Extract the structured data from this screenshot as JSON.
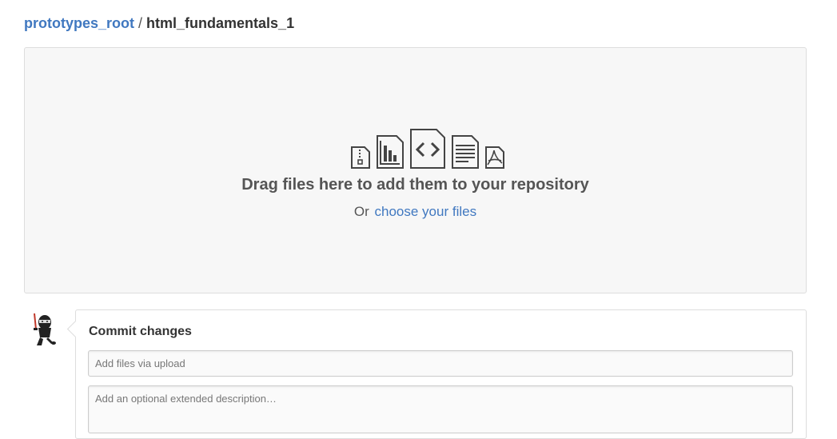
{
  "breadcrumb": {
    "owner": "prototypes_root",
    "separator": "/",
    "repo": "html_fundamentals_1"
  },
  "dropzone": {
    "icons": [
      "file-zip-icon",
      "file-media-icon",
      "file-code-icon",
      "file-text-icon",
      "file-pdf-icon"
    ],
    "title": "Drag files here to add them to your repository",
    "or_text": "Or",
    "choose_link": "choose your files"
  },
  "commit": {
    "title": "Commit changes",
    "summary_placeholder": "Add files via upload",
    "description_placeholder": "Add an optional extended description…"
  },
  "colors": {
    "link": "#4078c0",
    "dropzone_bg": "#f7f7f7",
    "border": "#dddddd"
  }
}
